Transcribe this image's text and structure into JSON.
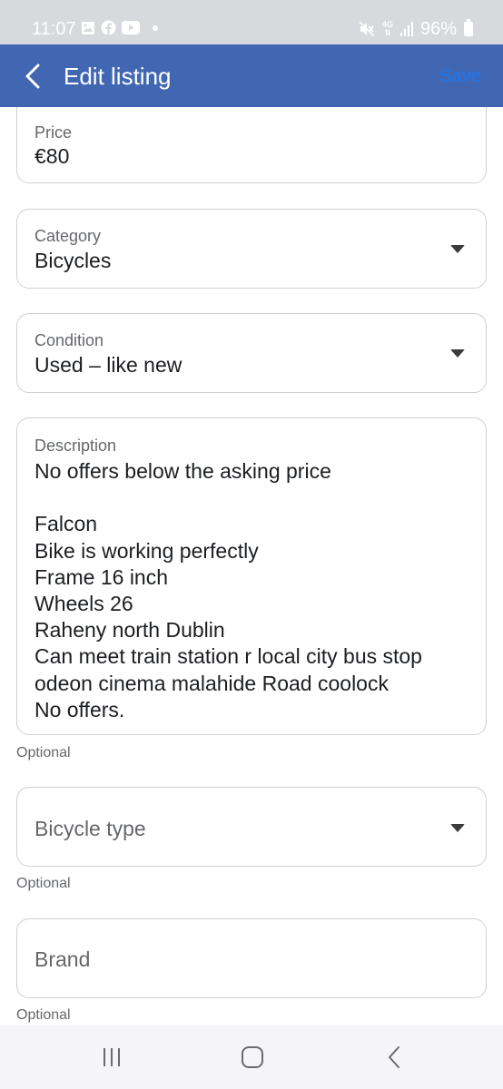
{
  "status_bar": {
    "time": "11:07",
    "network": "4G",
    "battery": "96%",
    "icons": [
      "gallery-icon",
      "facebook-icon",
      "youtube-icon",
      "notification-dot",
      "mute-icon",
      "signal-icon",
      "battery-icon"
    ]
  },
  "header": {
    "title": "Edit listing",
    "save_label": "Save",
    "back_icon": "chevron-left-icon",
    "background_color": "#4267b2",
    "save_color": "#1877f2"
  },
  "form": {
    "price": {
      "label": "Price",
      "value": "€80"
    },
    "category": {
      "label": "Category",
      "value": "Bicycles"
    },
    "condition": {
      "label": "Condition",
      "value": "Used – like new"
    },
    "description": {
      "label": "Description",
      "value": "No offers below the asking price\n\nFalcon\nBike is working perfectly\nFrame 16 inch\nWheels 26\nRaheny north Dublin\nCan meet train station r local city bus stop\nodeon cinema malahide Road coolock\nNo offers.",
      "helper": "Optional"
    },
    "bicycle_type": {
      "placeholder": "Bicycle type",
      "helper": "Optional"
    },
    "brand": {
      "placeholder": "Brand",
      "helper": "Optional"
    }
  },
  "nav_bar": {
    "icons": [
      "recent-apps-icon",
      "home-icon",
      "back-icon"
    ]
  }
}
